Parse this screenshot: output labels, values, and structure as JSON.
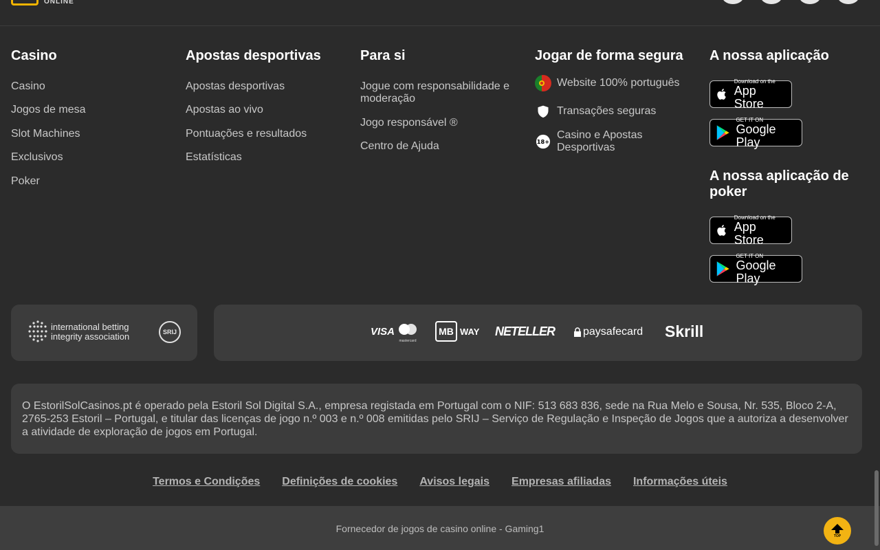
{
  "brand": {
    "logo_sub": "ONLINE"
  },
  "columns": [
    {
      "title": "Casino",
      "links": [
        "Casino",
        "Jogos de mesa",
        "Slot Machines",
        "Exclusivos",
        "Poker"
      ]
    },
    {
      "title": "Apostas desportivas",
      "links": [
        "Apostas desportivas",
        "Apostas ao vivo",
        "Pontuações e resultados",
        "Estatísticas"
      ]
    },
    {
      "title": "Para si",
      "links": [
        "Jogue com responsabilidade e moderação",
        "Jogo responsável ®",
        "Centro de Ajuda"
      ]
    }
  ],
  "safe_play": {
    "title": "Jogar de forma segura",
    "items": [
      {
        "icon": "portugal-flag-icon",
        "label": "Website 100% português"
      },
      {
        "icon": "shield-icon",
        "label": "Transações seguras"
      },
      {
        "icon": "age-18-icon",
        "label": "Casino e Apostas Desportivas",
        "badge": "18+"
      }
    ]
  },
  "apps": {
    "title": "A nossa aplicação",
    "poker_title": "A nossa aplicação de poker",
    "app_store": {
      "small": "Download on the",
      "big": "App Store"
    },
    "google_play": {
      "small": "GET IT ON",
      "big": "Google Play"
    }
  },
  "partners": {
    "ibia": [
      "international betting",
      "integrity association"
    ],
    "srij": "SRIJ"
  },
  "payments": {
    "visa": "VISA",
    "mastercard": "mastercard",
    "mbway_mb": "MB",
    "mbway_way": "WAY",
    "neteller": "NETELLER",
    "paysafecard": "paysafecard",
    "skrill": "Skrill"
  },
  "legal_text": "O EstorilSolCasinos.pt é operado pela Estoril Sol Digital S.A., empresa registada em Portugal com o NIF: 513 683 836, sede na Rua Melo e Sousa, Nr. 535, Bloco 2-A, 2765-253 Estoril – Portugal, e titular das licenças de jogo n.º 003 e n.º 008 emitidas pelo SRIJ – Serviço de Regulação e Inspeção de Jogos que a autoriza a desenvolver a atividade de exploração de jogos em Portugal.",
  "footer_links": [
    "Termos e Condições",
    "Definições de cookies",
    "Avisos legais",
    "Empresas afiliadas",
    "Informações úteis"
  ],
  "provider": "Fornecedor de jogos de casino online - Gaming1",
  "top_button": "TOP",
  "colors": {
    "background": "#2b2b2b",
    "panel": "#3c3c3c",
    "accent": "#f2b313"
  }
}
